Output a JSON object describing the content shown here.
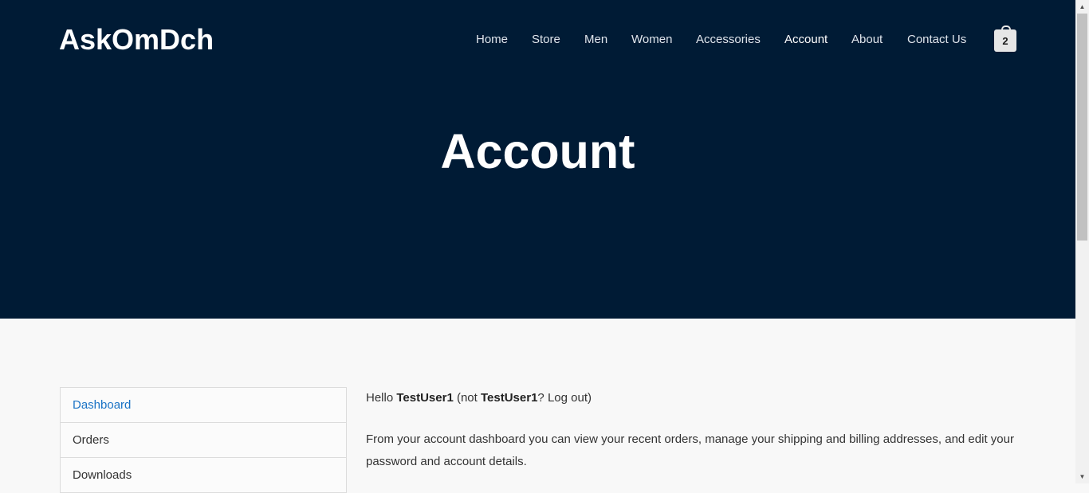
{
  "site": {
    "logo": "AskOmDch"
  },
  "nav": {
    "items": [
      {
        "label": "Home"
      },
      {
        "label": "Store"
      },
      {
        "label": "Men"
      },
      {
        "label": "Women"
      },
      {
        "label": "Accessories"
      },
      {
        "label": "Account"
      },
      {
        "label": "About"
      },
      {
        "label": "Contact Us"
      }
    ],
    "active": "Account",
    "cart_count": "2"
  },
  "hero": {
    "title": "Account"
  },
  "account_nav": {
    "items": [
      {
        "label": "Dashboard"
      },
      {
        "label": "Orders"
      },
      {
        "label": "Downloads"
      }
    ],
    "active": "Dashboard"
  },
  "dashboard": {
    "hello": "Hello ",
    "username": "TestUser1",
    "not_prefix": " (not ",
    "username_repeat": "TestUser1",
    "question": "? ",
    "logout_label": "Log out",
    "close_paren": ")",
    "intro": "From your account dashboard you can view your recent orders, manage your shipping and billing addresses, and edit your password and account details."
  },
  "colors": {
    "hero_bg": "#001b35",
    "page_bg": "#f8f8f8",
    "active_link": "#1a73c5"
  }
}
